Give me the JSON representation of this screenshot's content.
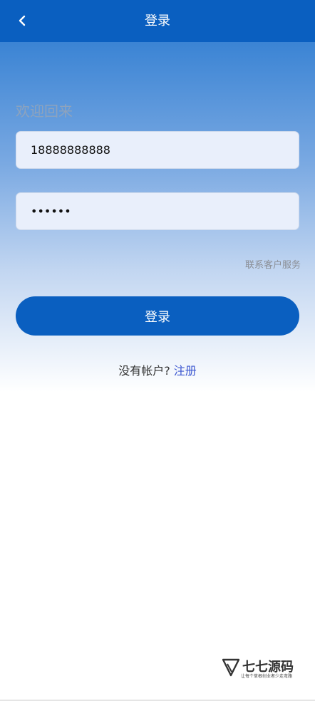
{
  "header": {
    "title": "登录",
    "back_icon": "chevron-left-icon"
  },
  "form": {
    "welcome": "欢迎回来",
    "phone_value": "18888888888",
    "password_value": "123456",
    "contact_service": "联系客户服务",
    "login_button": "登录",
    "no_account_text": "没有帐户?",
    "register_link": "注册"
  },
  "watermark": {
    "brand": "七七源码",
    "slogan": "让每个草根创业者少走弯路"
  },
  "colors": {
    "primary": "#0a5fc0",
    "link": "#3b56d0"
  }
}
